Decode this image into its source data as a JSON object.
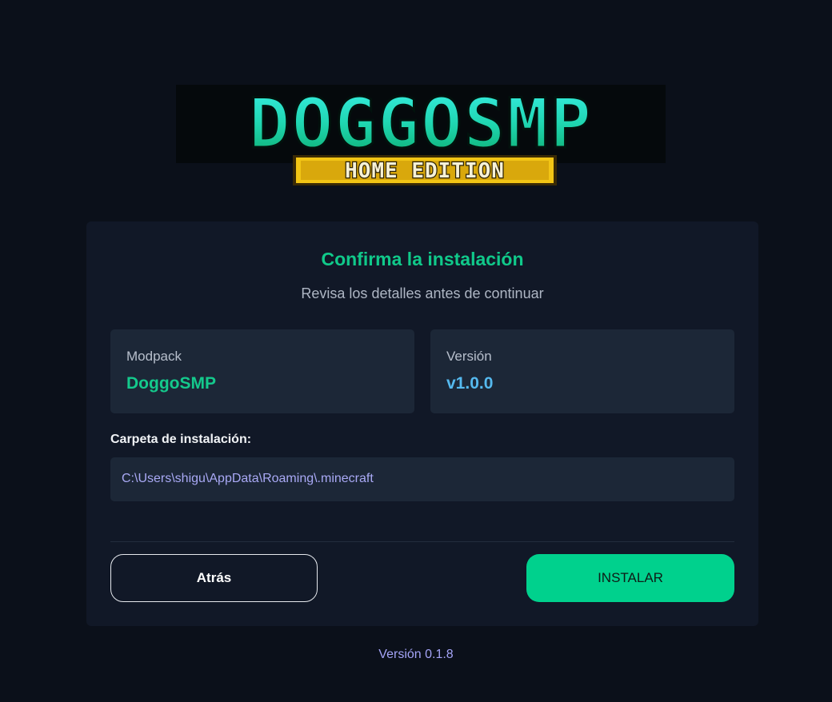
{
  "logo": {
    "title": "DOGGOSMP",
    "subtitle": "HOME EDITION",
    "colors": {
      "teal_top": "#2ee8dc",
      "teal_bottom": "#0fbf7a",
      "shadow": "#05090c",
      "badge": "#f2c515",
      "badge_text": "#f7f1d6"
    }
  },
  "card": {
    "title": "Confirma la instalación",
    "subtitle": "Revisa los detalles antes de continuar",
    "modpack": {
      "label": "Modpack",
      "value": "DoggoSMP"
    },
    "version": {
      "label": "Versión",
      "value": "v1.0.0"
    },
    "folder": {
      "label": "Carpeta de instalación:",
      "path": "C:\\Users\\shigu\\AppData\\Roaming\\.minecraft"
    },
    "back_button": "Atrás",
    "install_button": "INSTALAR"
  },
  "footer": {
    "version": "Versión 0.1.8"
  }
}
